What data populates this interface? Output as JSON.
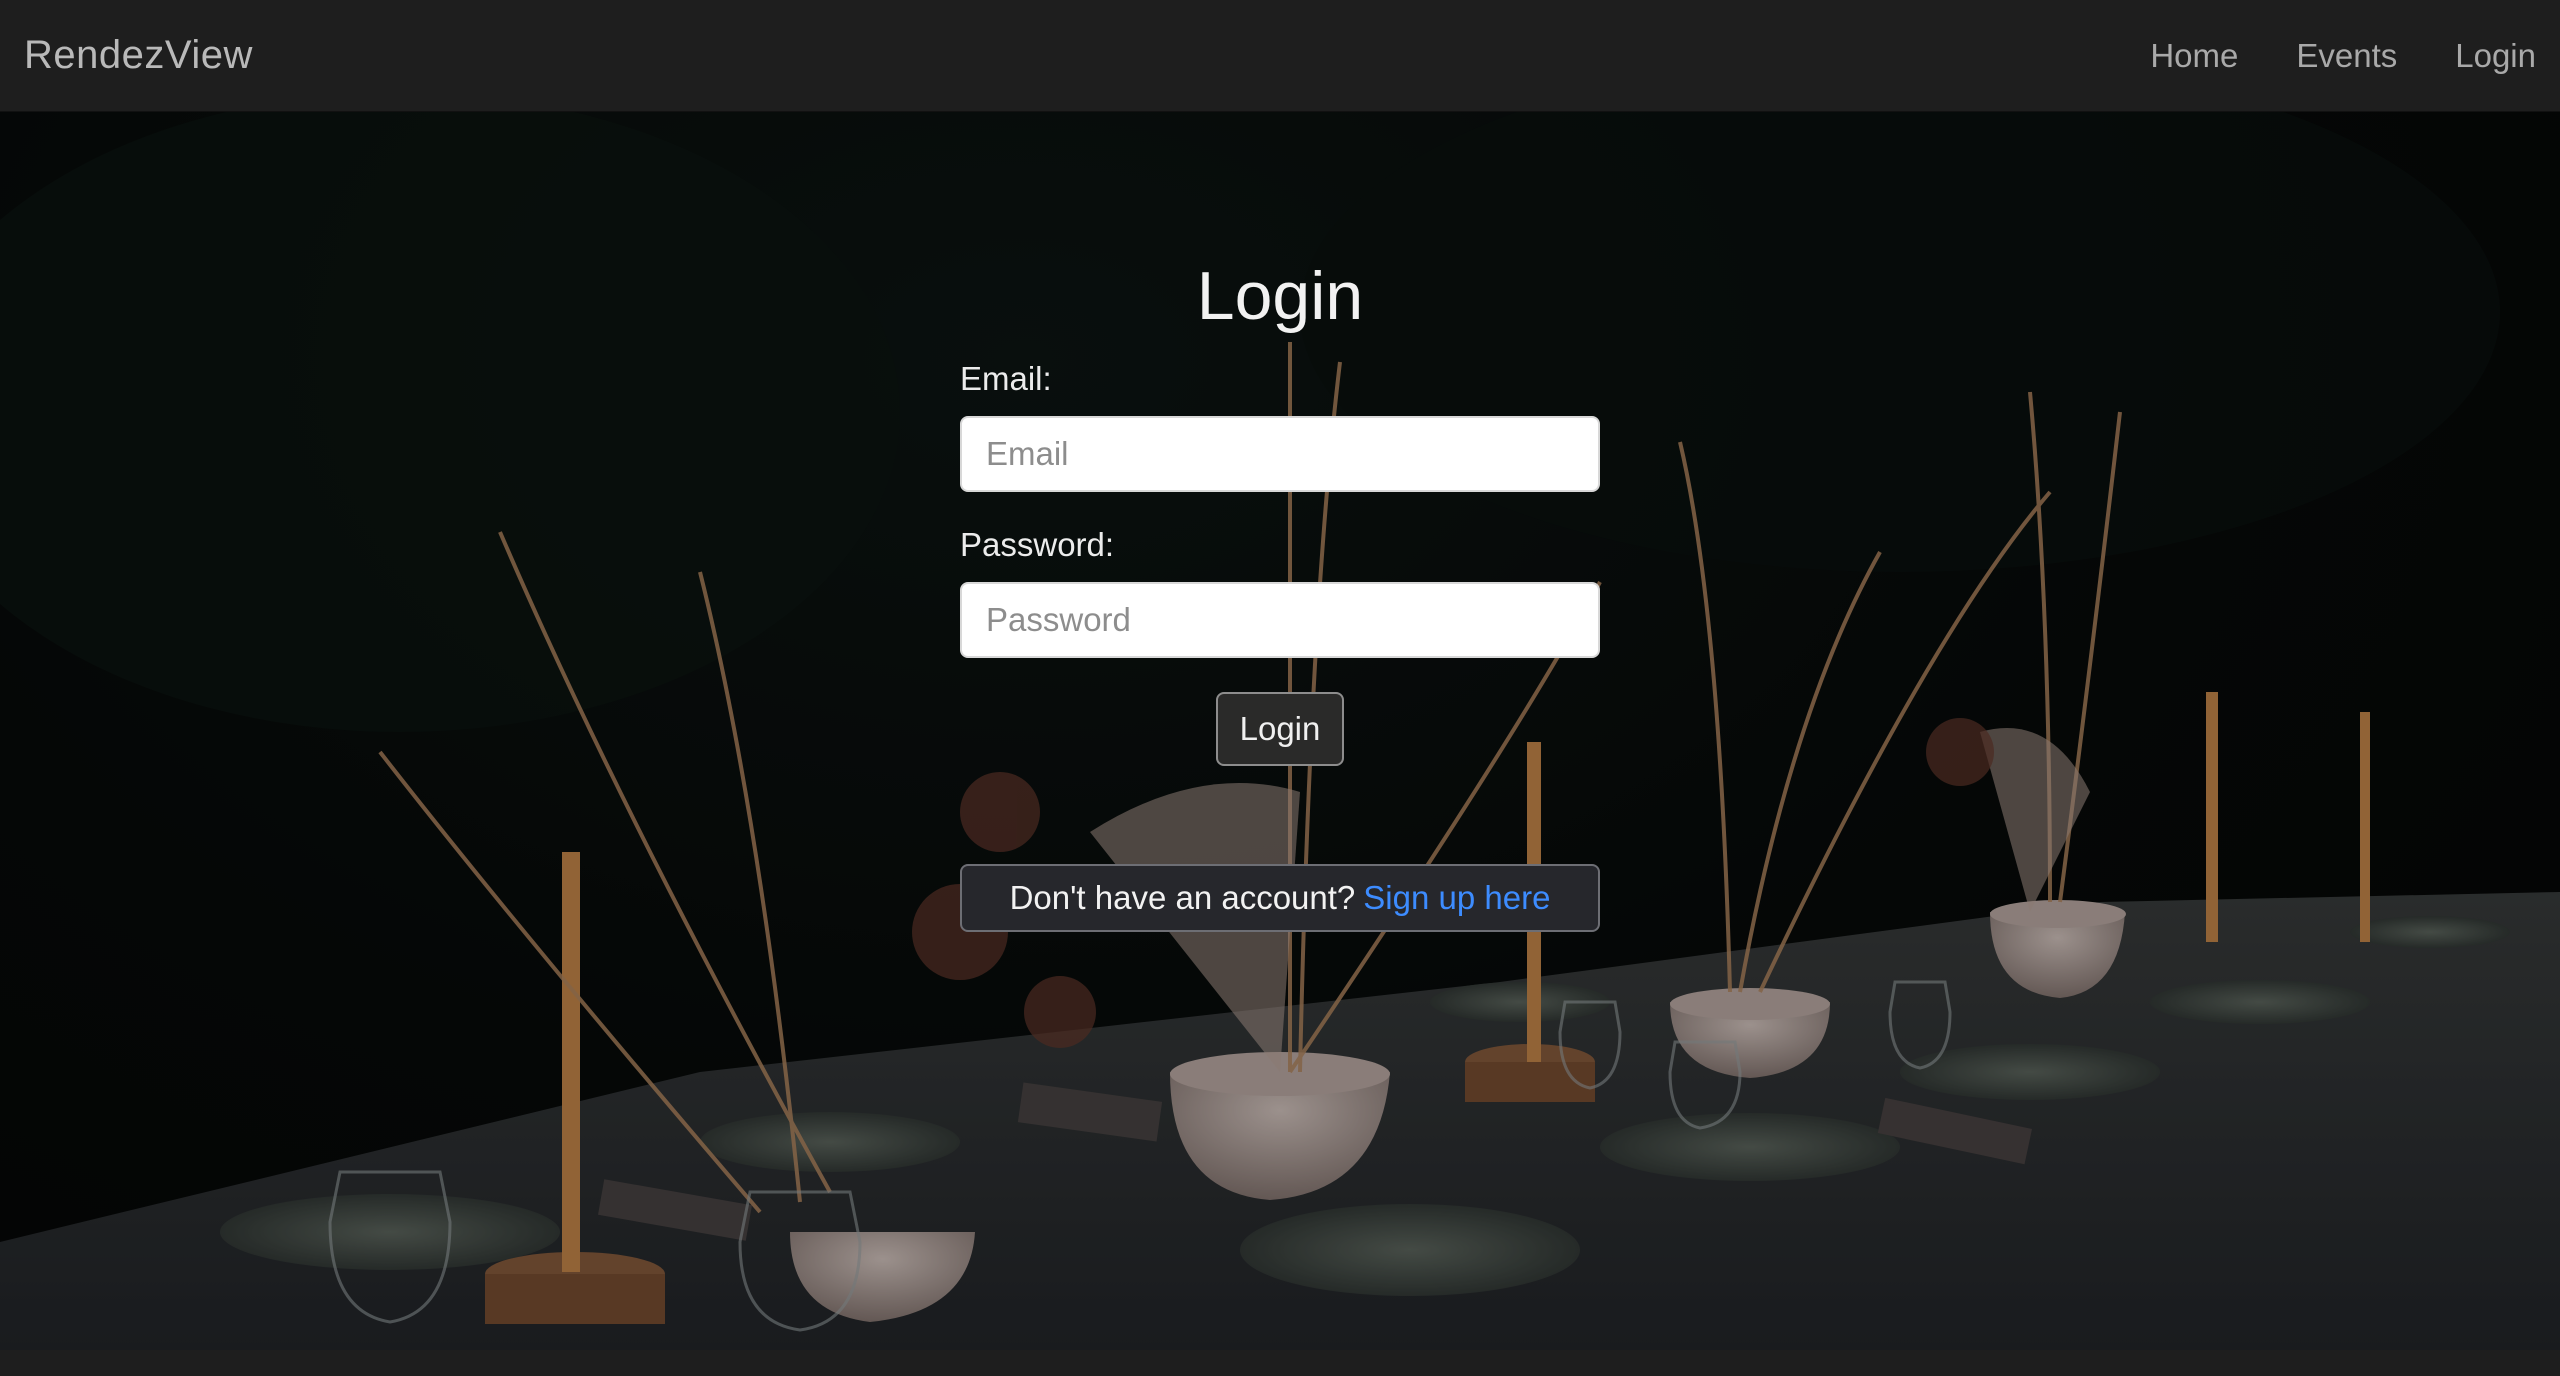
{
  "navbar": {
    "brand": "RendezView",
    "links": [
      {
        "label": "Home"
      },
      {
        "label": "Events"
      },
      {
        "label": "Login"
      }
    ]
  },
  "login": {
    "title": "Login",
    "email_label": "Email:",
    "email_placeholder": "Email",
    "email_value": "",
    "password_label": "Password:",
    "password_placeholder": "Password",
    "password_value": "",
    "submit_label": "Login",
    "signup_prompt": "Don't have an account?",
    "signup_link": "Sign up here"
  },
  "colors": {
    "navbar_bg": "#1e1e1e",
    "link_blue": "#3d8cff",
    "button_bg": "#2a2a29"
  }
}
